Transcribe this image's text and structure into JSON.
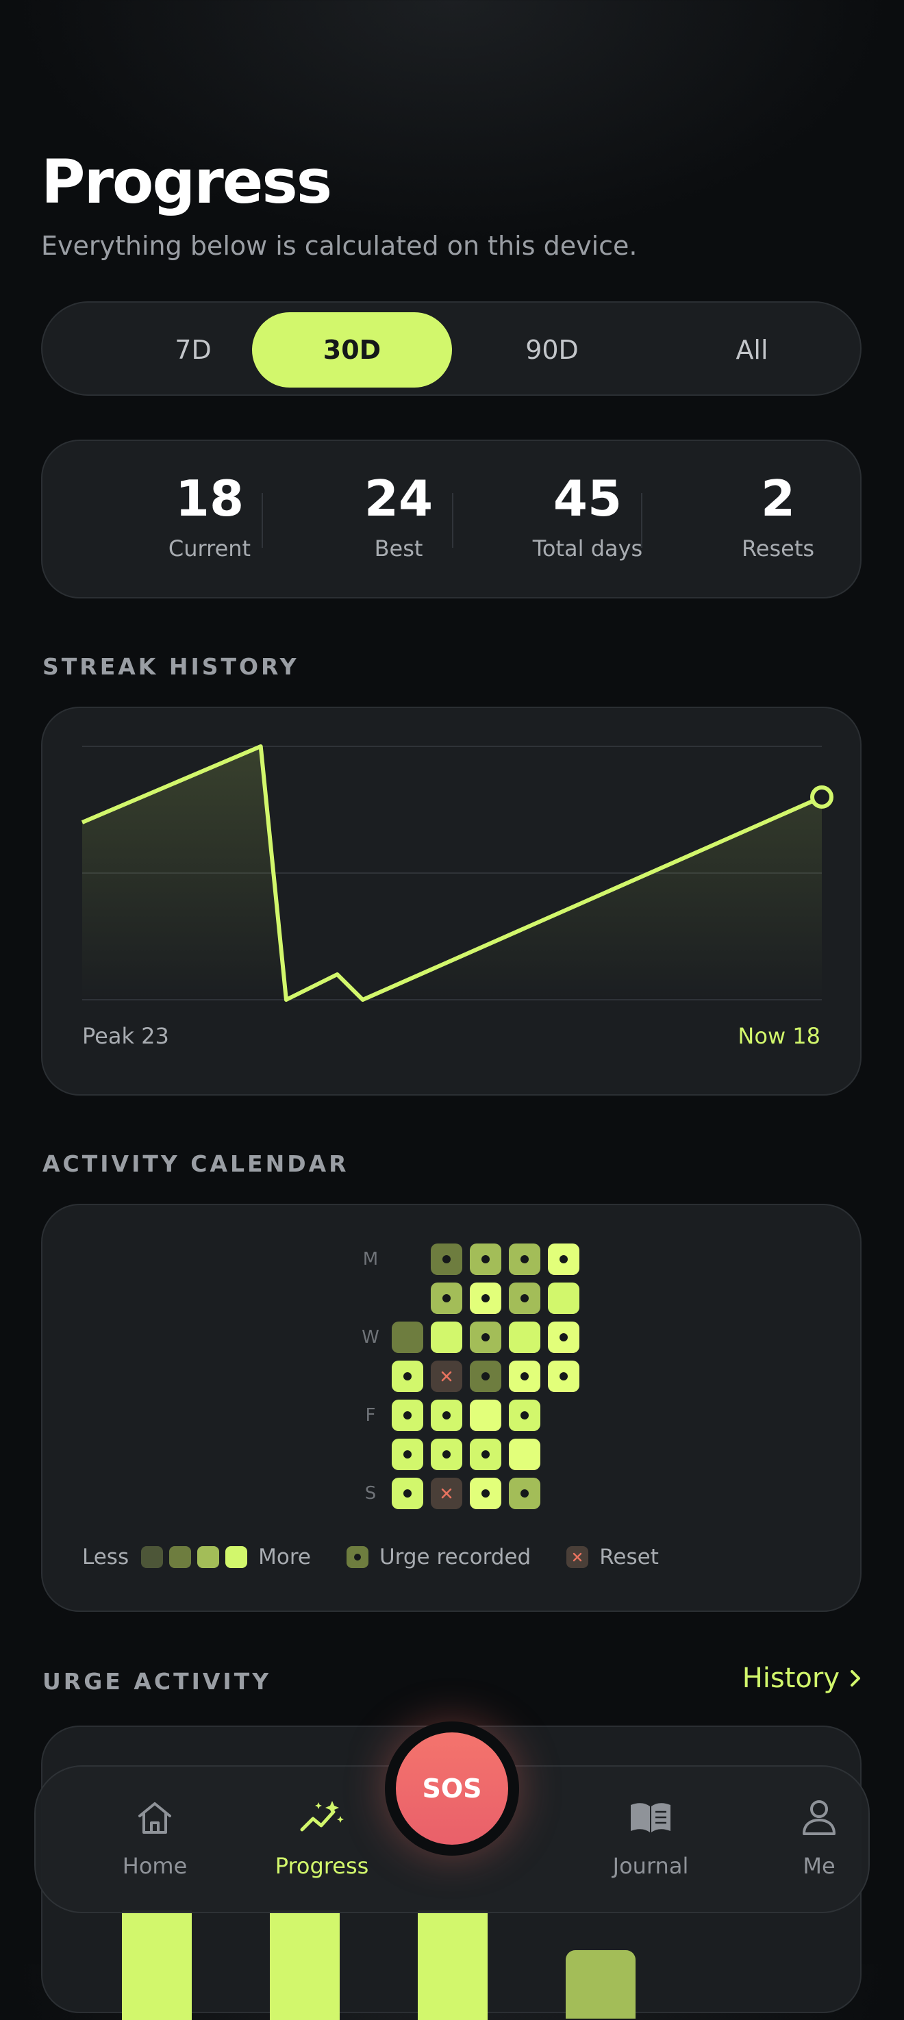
{
  "header": {
    "title": "Progress",
    "subtitle": "Everything below is calculated on this device."
  },
  "range_tabs": [
    {
      "label": "7D",
      "active": false
    },
    {
      "label": "30D",
      "active": true
    },
    {
      "label": "90D",
      "active": false
    },
    {
      "label": "All",
      "active": false
    }
  ],
  "stats": [
    {
      "value": "18",
      "label": "Current"
    },
    {
      "value": "24",
      "label": "Best"
    },
    {
      "value": "45",
      "label": "Total days"
    },
    {
      "value": "2",
      "label": "Resets"
    }
  ],
  "sections": {
    "streak_history": "STREAK HISTORY",
    "activity_calendar": "ACTIVITY CALENDAR",
    "urge_activity": "URGE ACTIVITY",
    "history_link": "History"
  },
  "colors": {
    "accent": "#d2f76c",
    "reset": "#e8735f",
    "sos": "#f06c6c",
    "card": "#1b1e21"
  },
  "chart_data": {
    "type": "area",
    "x": [
      0,
      7,
      8,
      10,
      11,
      29
    ],
    "values": [
      7,
      10,
      0,
      1,
      0,
      8
    ],
    "ylim": [
      0,
      10
    ],
    "grid": true,
    "peak_label": "Peak 23",
    "now_label": "Now 18"
  },
  "calendar": {
    "day_labels": [
      "M",
      "",
      "W",
      "",
      "F",
      "",
      "S"
    ],
    "cells": [
      [
        null,
        1,
        2,
        2,
        4
      ],
      [
        null,
        2,
        4,
        2,
        3
      ],
      [
        1,
        3,
        2,
        3,
        4
      ],
      [
        3,
        0,
        1,
        4,
        4
      ],
      [
        3,
        3,
        4,
        3,
        null
      ],
      [
        3,
        3,
        3,
        4,
        null
      ],
      [
        3,
        0,
        4,
        2,
        null
      ]
    ],
    "urge": [
      [
        false,
        true,
        true,
        true,
        true
      ],
      [
        false,
        true,
        true,
        true,
        false
      ],
      [
        false,
        false,
        true,
        false,
        true
      ],
      [
        true,
        false,
        true,
        true,
        true
      ],
      [
        true,
        true,
        false,
        true,
        false
      ],
      [
        true,
        true,
        true,
        false,
        false
      ],
      [
        true,
        false,
        true,
        true,
        false
      ]
    ],
    "reset": [
      [
        false,
        false,
        false,
        false,
        false
      ],
      [
        false,
        false,
        false,
        false,
        false
      ],
      [
        false,
        false,
        false,
        false,
        false
      ],
      [
        false,
        true,
        false,
        false,
        false
      ],
      [
        false,
        false,
        false,
        false,
        false
      ],
      [
        false,
        false,
        false,
        false,
        false
      ],
      [
        false,
        true,
        false,
        false,
        false
      ]
    ],
    "legend": {
      "less": "Less",
      "more": "More",
      "urge": "Urge recorded",
      "reset": "Reset"
    }
  },
  "nav": {
    "items": [
      {
        "label": "Home",
        "icon": "home-icon",
        "active": false
      },
      {
        "label": "Progress",
        "icon": "trend-icon",
        "active": true
      },
      {
        "label": "Journal",
        "icon": "book-icon",
        "active": false
      },
      {
        "label": "Me",
        "icon": "person-icon",
        "active": false
      }
    ],
    "sos_label": "SOS"
  }
}
